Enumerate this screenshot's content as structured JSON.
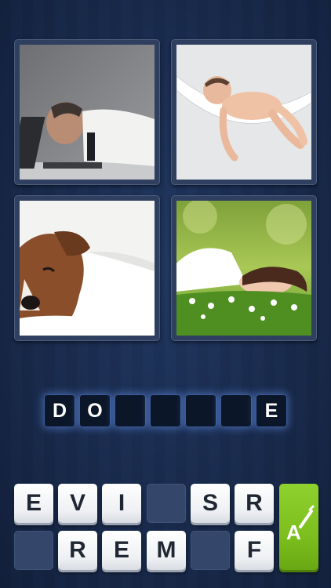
{
  "puzzle": {
    "images": [
      {
        "id": "tired-man-laptop"
      },
      {
        "id": "baby-hammock"
      },
      {
        "id": "dog-bed"
      },
      {
        "id": "woman-grass"
      }
    ]
  },
  "answer_slots": [
    "D",
    "O",
    "",
    "",
    "",
    "",
    "E"
  ],
  "letter_keys": {
    "row1": [
      "E",
      "V",
      "I",
      "",
      "S",
      "R"
    ],
    "row2": [
      "",
      "R",
      "E",
      "M",
      "",
      "F"
    ]
  },
  "hint_button": {
    "icon": "magic-wand-icon",
    "label": "A"
  },
  "colors": {
    "background": "#1b2c4f",
    "slot_glow": "#6ea0ff",
    "key_face": "#ffffff",
    "hint_green": "#7cbf1e"
  }
}
